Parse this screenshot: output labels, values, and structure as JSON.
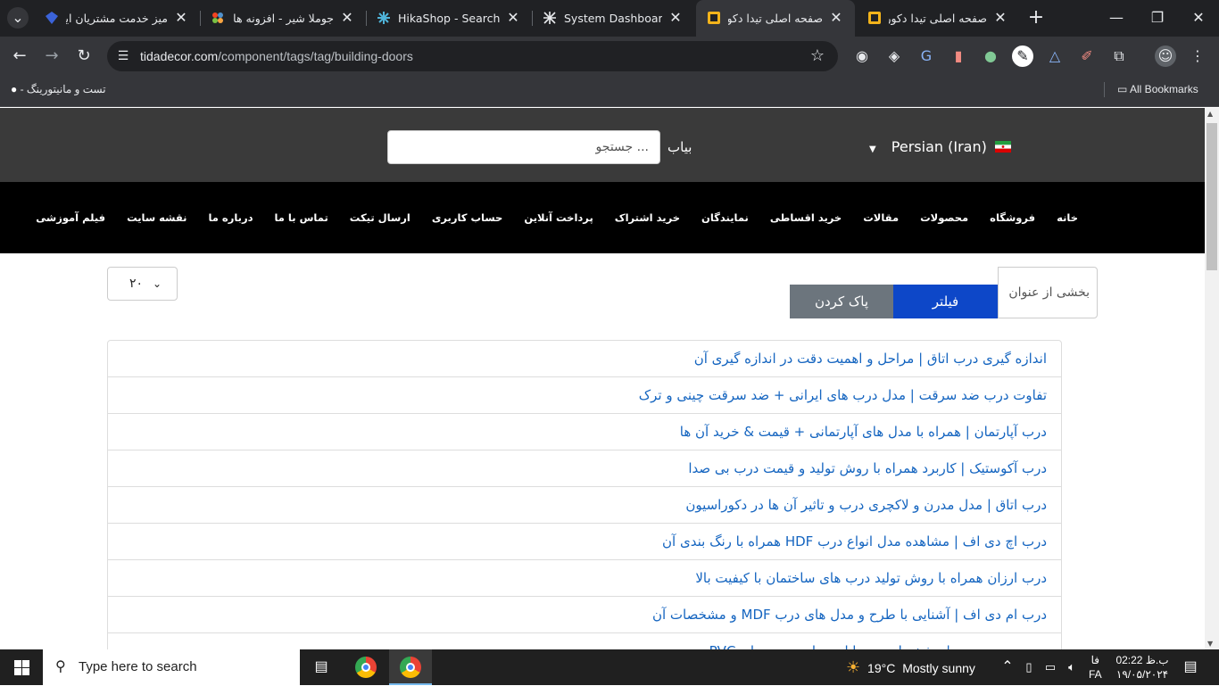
{
  "browser": {
    "tabs": [
      {
        "title": "میز خدمت مشتریان ایرا",
        "icon": "diamond-icon"
      },
      {
        "title": "جوملا شیر - افزونه ها و",
        "icon": "joomla-icon"
      },
      {
        "title": "HikaShop - Search by",
        "icon": "hikashop-icon"
      },
      {
        "title": "System Dashboard - ",
        "icon": "dashboard-x-icon"
      },
      {
        "title": "صفحه اصلی تیدا دکور",
        "icon": "tidadecor-icon"
      },
      {
        "title": "صفحه اصلی تیدا دکور",
        "icon": "tidadecor-icon"
      }
    ],
    "active_tab": 4,
    "url_host": "tidadecor.com",
    "url_path": "/component/tags/tag/building-doors",
    "bookmark_item": "تست و مانیتورینگ -",
    "all_bookmarks": "All Bookmarks"
  },
  "site": {
    "search_placeholder": "جستجو ...",
    "search_label": "بیاب",
    "language": "Persian (Iran)",
    "nav": [
      "خانه",
      "فروشگاه",
      "محصولات",
      "مقالات",
      "خرید اقساطی",
      "نمایندگان",
      "خرید اشتراک",
      "پرداخت آنلاین",
      "حساب کاربری",
      "ارسال تیکت",
      "تماس با ما",
      "درباره ما",
      "نقشه سایت",
      "فیلم آموزشی"
    ],
    "filter_placeholder": "بخشی از عنوان",
    "filter_button": "فیلتر",
    "clear_button": "پاک کردن",
    "limit_value": "۲۰",
    "items": [
      "اندازه گیری درب اتاق | مراحل و اهمیت دقت در اندازه گیری آن",
      "تفاوت درب ضد سرقت | مدل درب های ایرانی + ضد سرقت چینی و ترک",
      "درب آپارتمان | همراه با مدل های آپارتمانی + قیمت & خرید آن ها",
      "درب آکوستیک | کاربرد همراه با روش تولید و قیمت درب بی صدا",
      "درب اتاق | مدل مدرن و لاکچری درب و تاثیر آن ها در دکوراسیون",
      "درب اچ دی اف | مشاهده مدل انواع درب HDF همراه با رنگ بندی آن",
      "درب ارزان همراه با روش تولید درب های ساختمان با کیفیت بالا",
      "درب ام دی اف | آشنایی با طرح و مدل های درب MDF و مشخصات آن",
      "درب پی وی سی | مشخصات و مزایا و معایب درب های PVC"
    ]
  },
  "taskbar": {
    "search_placeholder": "Type here to search",
    "weather_temp": "19°C",
    "weather_text": "Mostly sunny",
    "lang": "FA",
    "time": "02:22 ب.ظ",
    "date": "۱۹/۰۵/۲۰۲۴",
    "day": "فا"
  },
  "colors": {
    "link": "#1565c0",
    "filter_btn": "#0d47c8",
    "clear_btn": "#6c757d",
    "header": "#3a3a3a",
    "nav": "#000000"
  }
}
